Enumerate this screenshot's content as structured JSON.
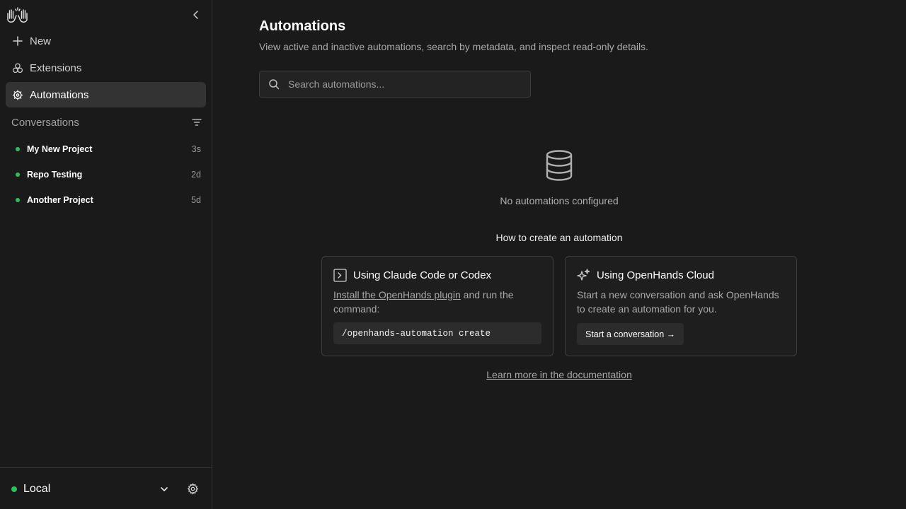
{
  "sidebar": {
    "nav": [
      {
        "label": "New",
        "icon": "plus-icon"
      },
      {
        "label": "Extensions",
        "icon": "extensions-icon"
      },
      {
        "label": "Automations",
        "icon": "automations-gear-icon",
        "active": true
      }
    ],
    "conversations_label": "Conversations",
    "conversations": [
      {
        "title": "My New Project",
        "time": "3s",
        "status": "active"
      },
      {
        "title": "Repo Testing",
        "time": "2d",
        "status": "active"
      },
      {
        "title": "Another Project",
        "time": "5d",
        "status": "active"
      }
    ],
    "footer": {
      "runtime_label": "Local",
      "status": "connected"
    }
  },
  "main": {
    "title": "Automations",
    "subtitle": "View active and inactive automations, search by metadata, and inspect read-only details.",
    "search": {
      "placeholder": "Search automations...",
      "value": ""
    },
    "empty_state": "No automations configured",
    "howto_title": "How to create an automation",
    "cards": [
      {
        "title": "Using Claude Code or Codex",
        "icon": "terminal-icon",
        "link_text": "Install the OpenHands plugin",
        "body_rest": " and run the command:",
        "code": "/openhands-automation create"
      },
      {
        "title": "Using OpenHands Cloud",
        "icon": "sparkles-icon",
        "body": "Start a new conversation and ask OpenHands to create an automation for you.",
        "button": "Start a conversation →"
      }
    ],
    "docs_link": "Learn more in the documentation"
  },
  "colors": {
    "background": "#1a1a1a",
    "active_nav": "#333333",
    "status_green": "#22c55e",
    "border": "#3d3d3d"
  }
}
